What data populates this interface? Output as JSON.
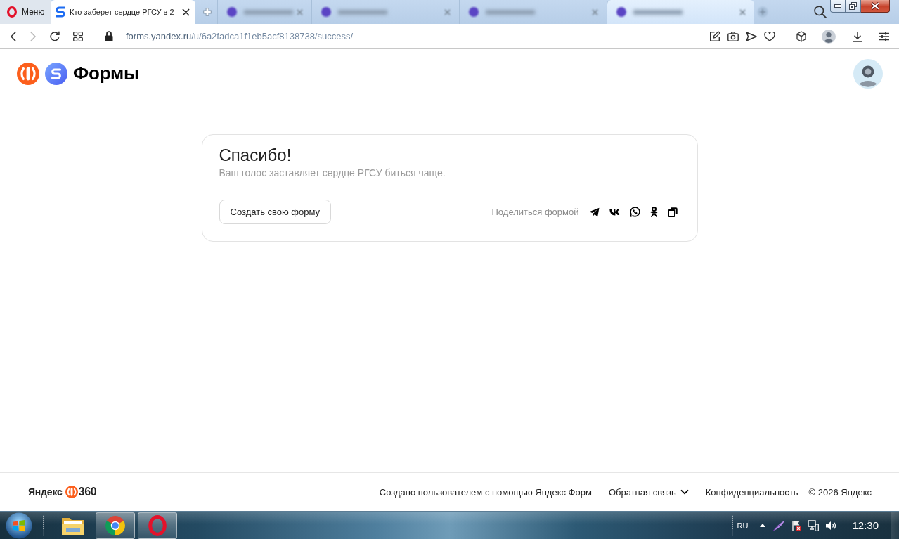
{
  "browser": {
    "menu_button": {
      "label": "Меню"
    },
    "tabs": [
      {
        "kind": "page",
        "label": "Кто заберет сердце РГСУ в 2",
        "selected": true,
        "hovered": false
      },
      {
        "kind": "blurred",
        "selected": false,
        "hovered": false
      },
      {
        "kind": "blurred",
        "selected": false,
        "hovered": false
      },
      {
        "kind": "blurred",
        "selected": false,
        "hovered": false
      },
      {
        "kind": "blurred",
        "selected": false,
        "hovered": true
      }
    ],
    "navigation": {
      "back_disabled": false,
      "forward_disabled": true
    },
    "address": {
      "host": "forms.yandex.ru",
      "path": "/u/6a2fadca1f1eb5acf8138738/success/"
    }
  },
  "header": {
    "app_name": "Формы"
  },
  "card": {
    "title": "Спасибо!",
    "message": "Ваш голос заставляет сердце РГСУ биться чаще.",
    "create_button": "Создать свою форму",
    "share_label": "Поделиться формой"
  },
  "footer": {
    "brand": {
      "name": "Яндекс",
      "suffix": "360"
    },
    "links": [
      {
        "kind": "link",
        "label": "Создано пользователем с помощью Яндекс Форм"
      },
      {
        "kind": "dropdown",
        "label": "Обратная связь"
      },
      {
        "kind": "link",
        "label": "Конфиденциальность"
      }
    ],
    "copyright": "© 2026 Яндекс"
  },
  "taskbar": {
    "apps": [
      {
        "kind": "folder",
        "running": false
      },
      {
        "kind": "chrome",
        "running": true
      },
      {
        "kind": "opera",
        "running": true
      }
    ],
    "language": "RU",
    "clock": "12:30"
  }
}
